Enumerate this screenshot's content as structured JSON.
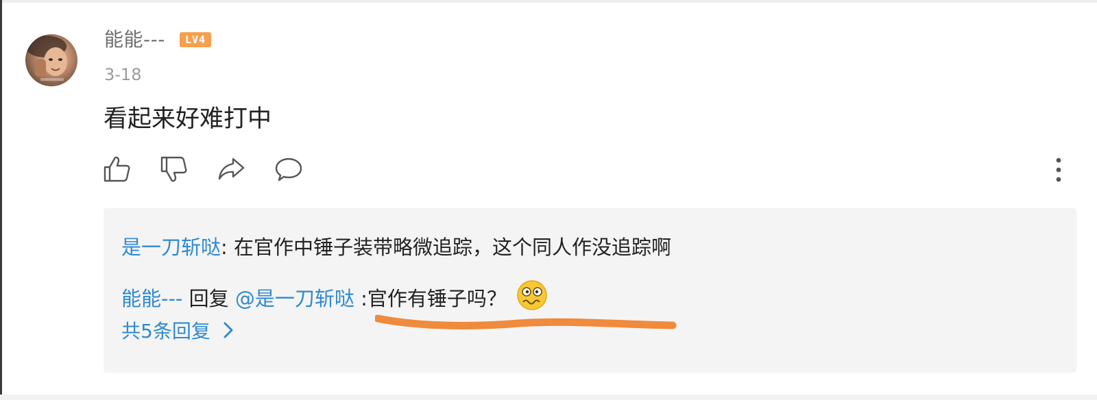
{
  "comment": {
    "author": "能能---",
    "level_badge": "LV4",
    "date": "3-18",
    "text": "看起来好难打中"
  },
  "actions": {
    "like_icon": "thumbs-up-icon",
    "dislike_icon": "thumbs-down-icon",
    "share_icon": "share-icon",
    "reply_icon": "comment-icon",
    "more_icon": "more-vertical-icon"
  },
  "replies": {
    "items": [
      {
        "author": "是一刀斩哒",
        "separator": ":",
        "text": " 在官作中锤子装带略微追踪，这个同人作没追踪啊"
      },
      {
        "author": "能能---",
        "reply_word": " 回复 ",
        "mention": "@是一刀斩哒",
        "separator": " :",
        "text": "官作有锤子吗？",
        "emoji": "dizzy-face-emoji"
      }
    ],
    "view_all_label": "共5条回复"
  },
  "colors": {
    "link_blue": "#2f8ad0",
    "level_badge": "#f6a04d",
    "reply_background": "#f4f4f4",
    "highlight_stroke": "#f08a3c",
    "username_gray": "#6e6e6e",
    "date_gray": "#9b9b9b"
  }
}
